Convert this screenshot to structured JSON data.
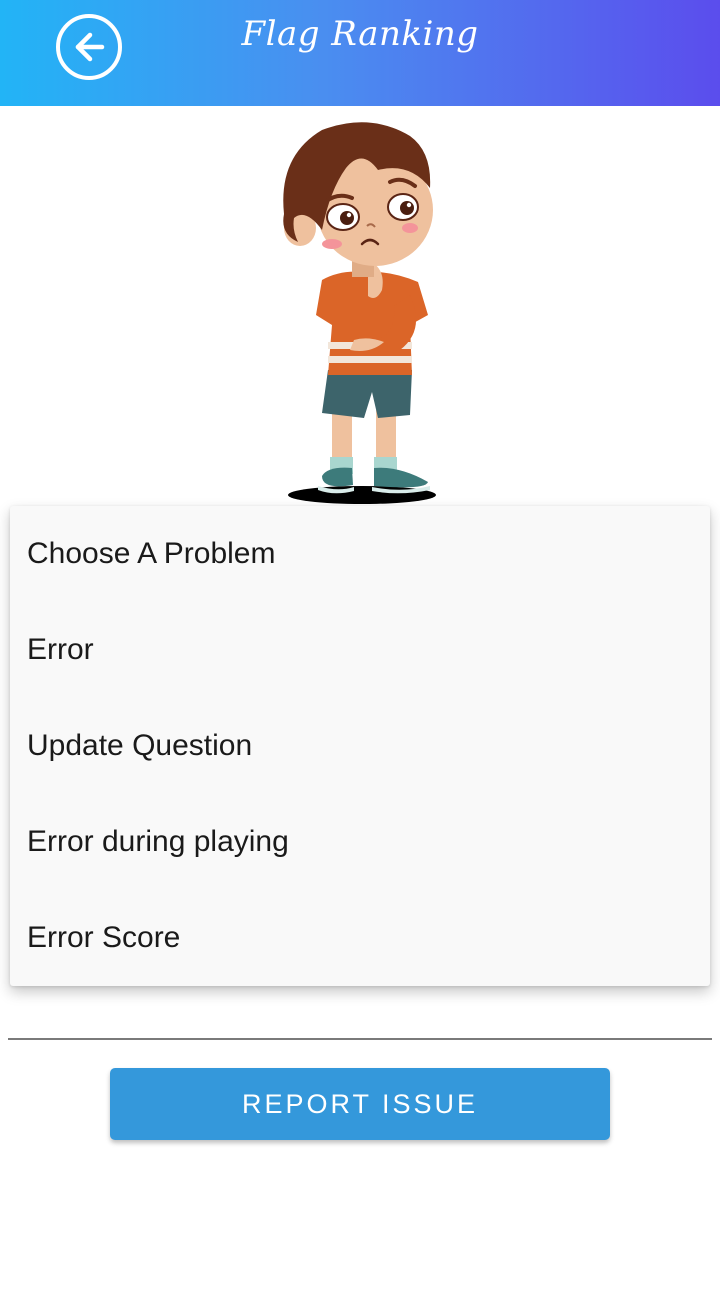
{
  "header": {
    "title": "Flag Ranking",
    "back_icon": "arrow-left-circle-icon",
    "gradient": [
      "#22b4f6",
      "#5b4ded"
    ]
  },
  "illustration": {
    "description_icon": "thinking-boy-illustration"
  },
  "problem_menu": {
    "items": [
      {
        "label": "Choose A Problem"
      },
      {
        "label": "Error"
      },
      {
        "label": "Update Question"
      },
      {
        "label": "Error during playing"
      },
      {
        "label": "Error Score"
      }
    ]
  },
  "report_button": {
    "label": "REPORT ISSUE",
    "color": "#3498db"
  }
}
